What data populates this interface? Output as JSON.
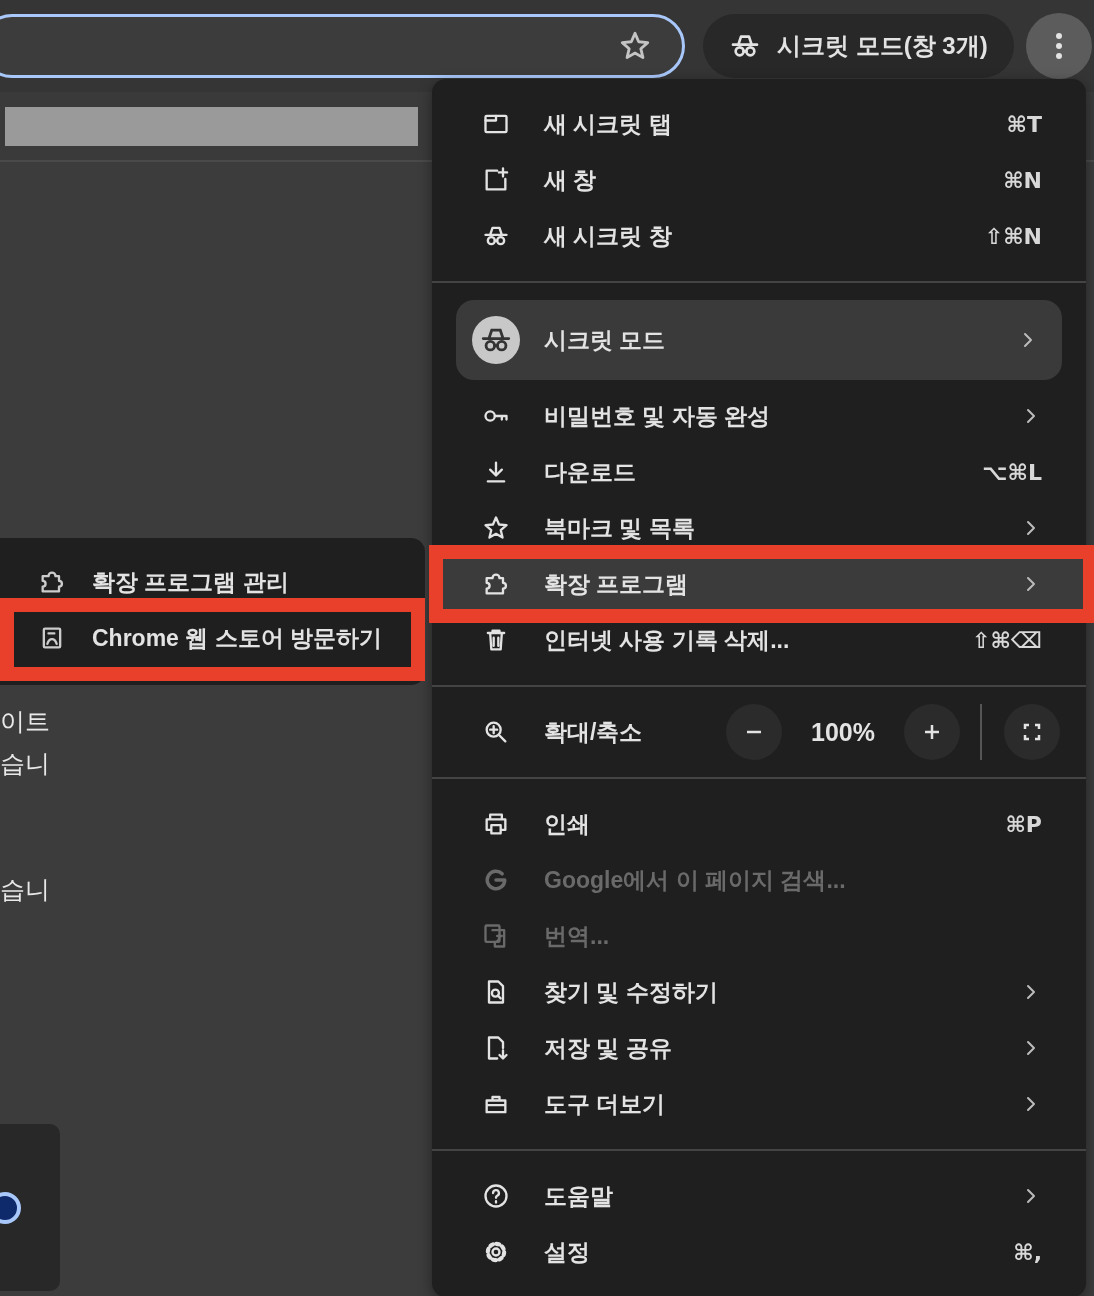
{
  "incognito_chip": {
    "label": "시크릿 모드(창 3개)"
  },
  "page_fragments": [
    "이트",
    "습니",
    "습니"
  ],
  "radio": {
    "selected": true
  },
  "menu": {
    "sections": [
      {
        "items": [
          {
            "kind": "item",
            "label": "새 시크릿 탭",
            "shortcut": "⌘T",
            "has_submenu": false,
            "disabled": false,
            "highlighted": false
          },
          {
            "kind": "item",
            "label": "새 창",
            "shortcut": "⌘N",
            "has_submenu": false,
            "disabled": false,
            "highlighted": false
          },
          {
            "kind": "item",
            "label": "새 시크릿 창",
            "shortcut": "⇧⌘N",
            "has_submenu": false,
            "disabled": false,
            "highlighted": false
          }
        ]
      },
      {
        "items": [
          {
            "kind": "profile",
            "label": "시크릿 모드",
            "has_submenu": true
          },
          {
            "kind": "item",
            "label": "비밀번호 및 자동 완성",
            "has_submenu": true,
            "disabled": false,
            "highlighted": false
          },
          {
            "kind": "item",
            "label": "다운로드",
            "shortcut": "⌥⌘L",
            "has_submenu": false,
            "disabled": false,
            "highlighted": false
          },
          {
            "kind": "item",
            "label": "북마크 및 목록",
            "has_submenu": true,
            "disabled": false,
            "highlighted": false
          },
          {
            "kind": "item",
            "label": "확장 프로그램",
            "has_submenu": true,
            "disabled": false,
            "highlighted": true
          },
          {
            "kind": "item",
            "label": "인터넷 사용 기록 삭제...",
            "shortcut": "⇧⌘⌫",
            "has_submenu": false,
            "disabled": false,
            "highlighted": false
          }
        ]
      },
      {
        "items": [
          {
            "kind": "zoom",
            "label": "확대/축소",
            "value": "100%"
          }
        ]
      },
      {
        "items": [
          {
            "kind": "item",
            "label": "인쇄",
            "shortcut": "⌘P",
            "has_submenu": false,
            "disabled": false,
            "highlighted": false
          },
          {
            "kind": "item",
            "label": "Google에서 이 페이지 검색...",
            "has_submenu": false,
            "disabled": true,
            "highlighted": false
          },
          {
            "kind": "item",
            "label": "번역...",
            "has_submenu": false,
            "disabled": true,
            "highlighted": false
          },
          {
            "kind": "item",
            "label": "찾기 및 수정하기",
            "has_submenu": true,
            "disabled": false,
            "highlighted": false
          },
          {
            "kind": "item",
            "label": "저장 및 공유",
            "has_submenu": true,
            "disabled": false,
            "highlighted": false
          },
          {
            "kind": "item",
            "label": "도구 더보기",
            "has_submenu": true,
            "disabled": false,
            "highlighted": false
          }
        ]
      },
      {
        "items": [
          {
            "kind": "item",
            "label": "도움말",
            "has_submenu": true,
            "disabled": false,
            "highlighted": false
          },
          {
            "kind": "item",
            "label": "설정",
            "shortcut": "⌘,",
            "has_submenu": false,
            "disabled": false,
            "highlighted": false
          }
        ]
      }
    ]
  },
  "submenu": {
    "items": [
      {
        "label": "확장 프로그램 관리",
        "highlighted": false
      },
      {
        "label": "Chrome 웹 스토어 방문하기",
        "highlighted": true
      }
    ]
  }
}
